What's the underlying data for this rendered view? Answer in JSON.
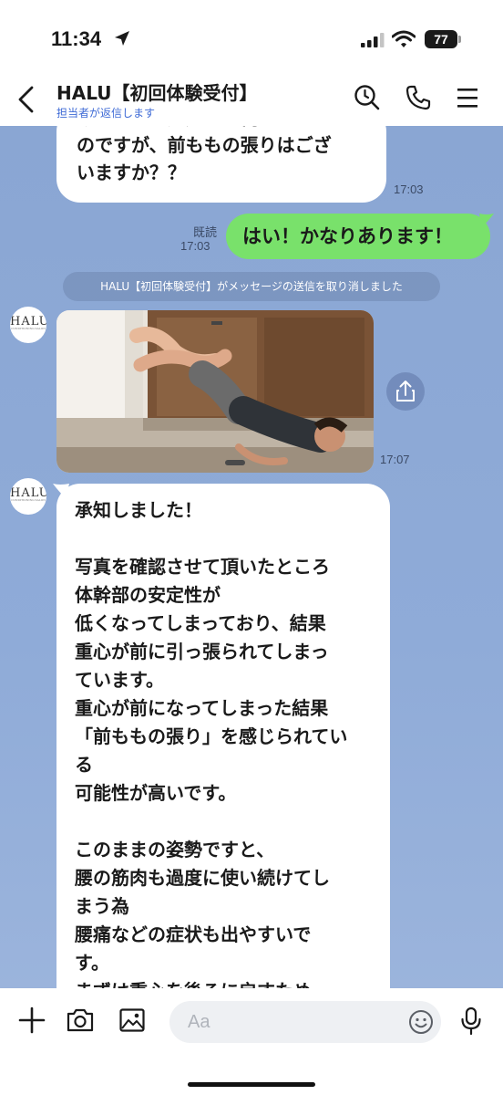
{
  "status_bar": {
    "time": "11:34",
    "battery": "77"
  },
  "header": {
    "title": "HALU【初回体験受付】",
    "subtitle": "担当者が返信します"
  },
  "messages": {
    "partial_top": {
      "text": "げるために追加でお伺いしたい\nのですが、前ももの張りはござ\nいますか？？",
      "time": "17:03"
    },
    "my_reply": {
      "read_label": "既読",
      "time": "17:03",
      "text": "はい！かなりあります！"
    },
    "system_notice": "HALU【初回体験受付】がメッセージの送信を取り消しました",
    "photo_message": {
      "time": "17:07"
    },
    "long_reply": {
      "text": "承知しました！\n\n写真を確認させて頂いたところ\n体幹部の安定性が\n低くなってしまっており、結果\n重心が前に引っ張られてしまっ\nています。\n重心が前になってしまった結果\n「前ももの張り」を感じられてい\nる\n可能性が高いです。\n\nこのままの姿勢ですと、\n腰の筋肉も過度に使い続けてし\nまう為\n腰痛などの症状も出やすいで\nす。\nまずは重心を後ろに戻すため、\n下記のエクササイズがオススメ"
    }
  },
  "avatar": {
    "logo_text": "HALU",
    "logo_sub": "CONDITIONING SALON"
  },
  "input": {
    "placeholder": "Aa"
  },
  "icons": [
    "back-icon",
    "search-icon",
    "phone-icon",
    "menu-icon",
    "plus-icon",
    "camera-icon",
    "image-icon",
    "emoji-icon",
    "mic-icon",
    "share-icon",
    "location-arrow-icon",
    "signal-icon",
    "wifi-icon"
  ],
  "colors": {
    "chat_background": "#8ea9d6",
    "my_bubble": "#79e16b",
    "their_bubble": "#ffffff",
    "subtitle_link": "#3f6bd6"
  }
}
